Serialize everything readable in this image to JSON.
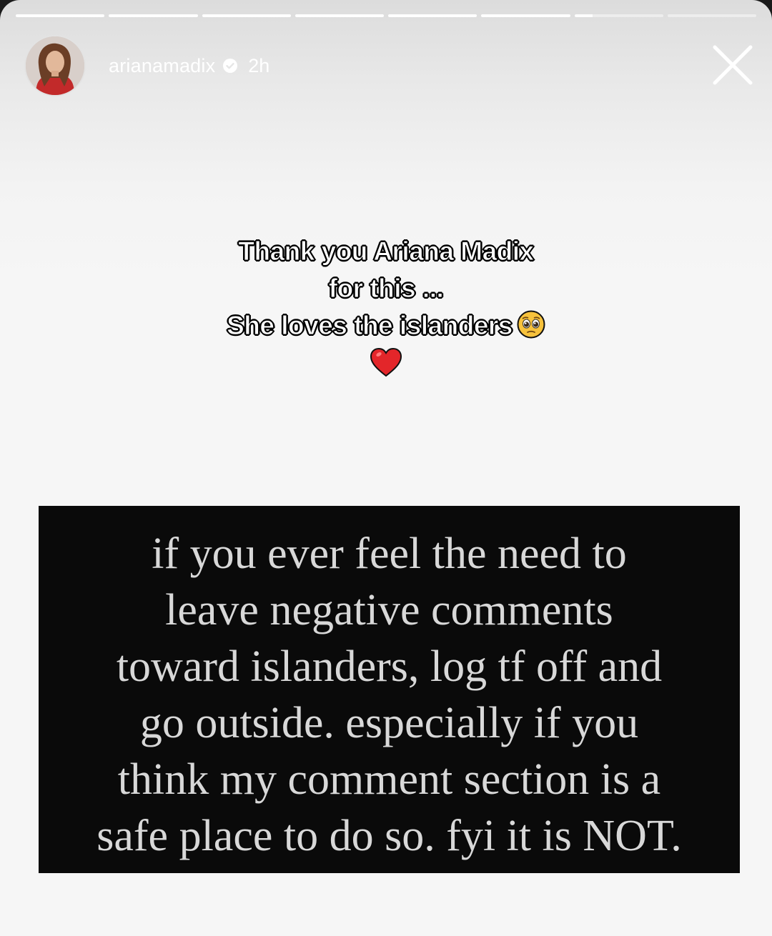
{
  "story": {
    "progress": {
      "segments": 8,
      "current_index": 7,
      "current_fraction": 0.2
    },
    "header": {
      "username": "arianamadix",
      "time_ago": "2h"
    },
    "caption": {
      "lines": [
        "Thank you Ariana Madix",
        "for this ...",
        "She loves the islanders"
      ],
      "emoji_after_line_3": "pleading-face",
      "emoji_last_line": "red-heart"
    },
    "quote_image": {
      "lines": [
        "if you ever feel the need to",
        "leave negative comments",
        "toward islanders, log tf off and",
        "go outside. especially if you",
        "think my comment section is a",
        "safe place to do so. fyi it is NOT."
      ]
    },
    "colors": {
      "quote_background": "#0a0a0a",
      "quote_text": "#d8d8d8",
      "verified_badge": "#ffffff"
    }
  }
}
